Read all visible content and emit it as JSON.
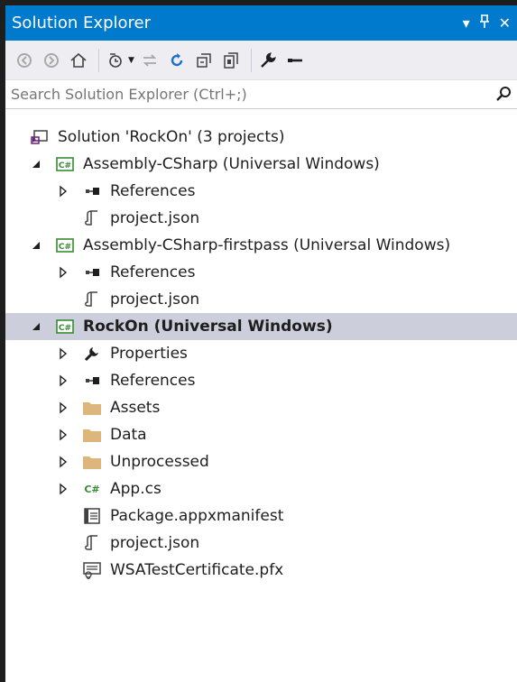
{
  "window": {
    "title": "Solution Explorer",
    "controls": [
      "▾",
      "⊐",
      "✕"
    ]
  },
  "search": {
    "placeholder": "Search Solution Explorer (Ctrl+;)"
  },
  "tree": [
    {
      "label": "Solution 'RockOn' (3 projects)",
      "icon": "solution-icon",
      "level": 0,
      "expander": "none"
    },
    {
      "label": "Assembly-CSharp (Universal Windows)",
      "icon": "csharp-project-icon",
      "level": 0,
      "expander": "expanded"
    },
    {
      "label": "References",
      "icon": "references-icon",
      "level": 1,
      "expander": "collapsed"
    },
    {
      "label": "project.json",
      "icon": "json-file-icon",
      "level": 1,
      "expander": "none"
    },
    {
      "label": "Assembly-CSharp-firstpass (Universal Windows)",
      "icon": "csharp-project-icon",
      "level": 0,
      "expander": "expanded"
    },
    {
      "label": "References",
      "icon": "references-icon",
      "level": 1,
      "expander": "collapsed"
    },
    {
      "label": "project.json",
      "icon": "json-file-icon",
      "level": 1,
      "expander": "none"
    },
    {
      "label": "RockOn (Universal Windows)",
      "icon": "csharp-project-icon",
      "level": 0,
      "expander": "expanded",
      "selected": true
    },
    {
      "label": "Properties",
      "icon": "wrench-icon",
      "level": 1,
      "expander": "collapsed"
    },
    {
      "label": "References",
      "icon": "references-icon",
      "level": 1,
      "expander": "collapsed"
    },
    {
      "label": "Assets",
      "icon": "folder-icon",
      "level": 1,
      "expander": "collapsed"
    },
    {
      "label": "Data",
      "icon": "folder-icon",
      "level": 1,
      "expander": "collapsed"
    },
    {
      "label": "Unprocessed",
      "icon": "folder-icon",
      "level": 1,
      "expander": "collapsed"
    },
    {
      "label": "App.cs",
      "icon": "csharp-file-icon",
      "level": 1,
      "expander": "collapsed"
    },
    {
      "label": "Package.appxmanifest",
      "icon": "manifest-icon",
      "level": 1,
      "expander": "none"
    },
    {
      "label": "project.json",
      "icon": "json-file-icon",
      "level": 1,
      "expander": "none"
    },
    {
      "label": "WSATestCertificate.pfx",
      "icon": "certificate-icon",
      "level": 1,
      "expander": "none"
    }
  ],
  "colors": {
    "accent": "#007acc",
    "selection": "#cccedb",
    "folder": "#dcb67a",
    "csharp": "#388a34"
  }
}
